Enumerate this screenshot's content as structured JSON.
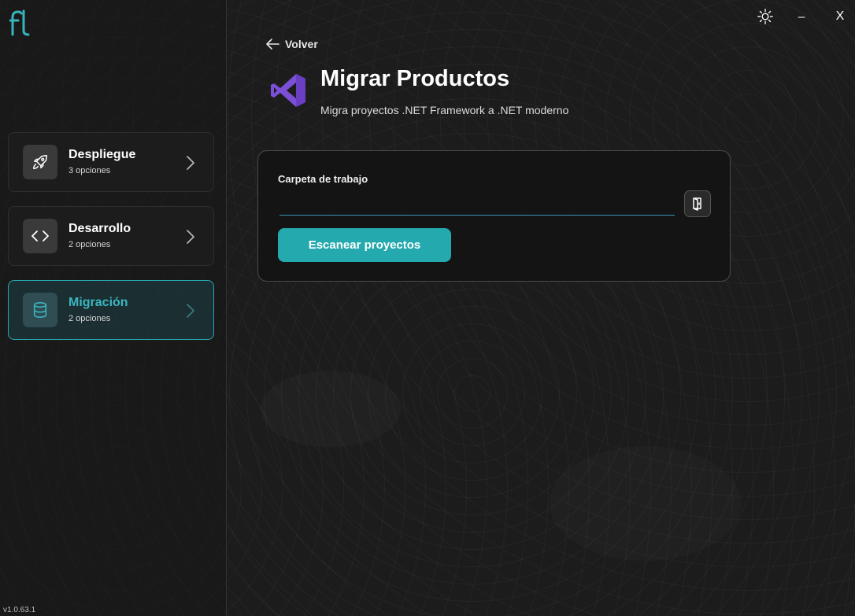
{
  "sidebar": {
    "logo_text": "fl",
    "items": [
      {
        "title": "Despliegue",
        "subtitle": "3 opciones",
        "icon": "rocket-icon"
      },
      {
        "title": "Desarrollo",
        "subtitle": "2 opciones",
        "icon": "code-icon"
      },
      {
        "title": "Migración",
        "subtitle": "2 opciones",
        "icon": "database-icon",
        "active": true
      }
    ],
    "version": "v1.0.63.1"
  },
  "window_controls": {
    "theme_icon": "sun-icon",
    "minimize_label": "–",
    "close_label": "X"
  },
  "main": {
    "back_label": "Volver",
    "title": "Migrar Productos",
    "subtitle": "Migra proyectos .NET Framework a .NET moderno",
    "header_icon": "visual-studio-icon",
    "form": {
      "field_label": "Carpeta de trabajo",
      "field_value": "",
      "folder_button_icon": "folder-icon",
      "scan_button_label": "Escanear proyectos"
    }
  },
  "colors": {
    "accent": "#23a9ae",
    "active_text": "#3ab6c0",
    "input_underline": "#3d8fb7",
    "background": "#1c1c1c",
    "visual_studio": "#7b4fd6"
  }
}
